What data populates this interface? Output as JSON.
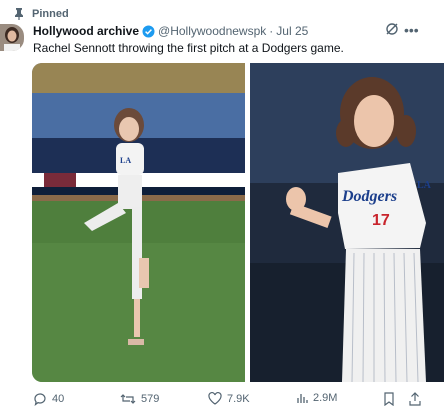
{
  "pinned": {
    "label": "Pinned",
    "icon": "pin-icon"
  },
  "post": {
    "author_name": "Hollywood archive",
    "handle": "@Hollywoodnewspk",
    "separator": "·",
    "date": "Jul 25",
    "text": "Rachel Sennott throwing the first pitch at a Dodgers game.",
    "verified_icon": "verified-badge-icon",
    "more_icon": "more-horizontal-icon",
    "grok_icon": "grok-icon"
  },
  "media": {
    "images": [
      "photo-pitching-windup",
      "photo-closeup-dodgers-jersey"
    ],
    "jersey_text": "Dodgers",
    "jersey_number": "17"
  },
  "actions": {
    "replies": "40",
    "reposts": "579",
    "likes": "7.9K",
    "views": "2.9M"
  },
  "colors": {
    "text_primary": "#0f1419",
    "text_secondary": "#536471",
    "verified": "#1d9bf0"
  }
}
